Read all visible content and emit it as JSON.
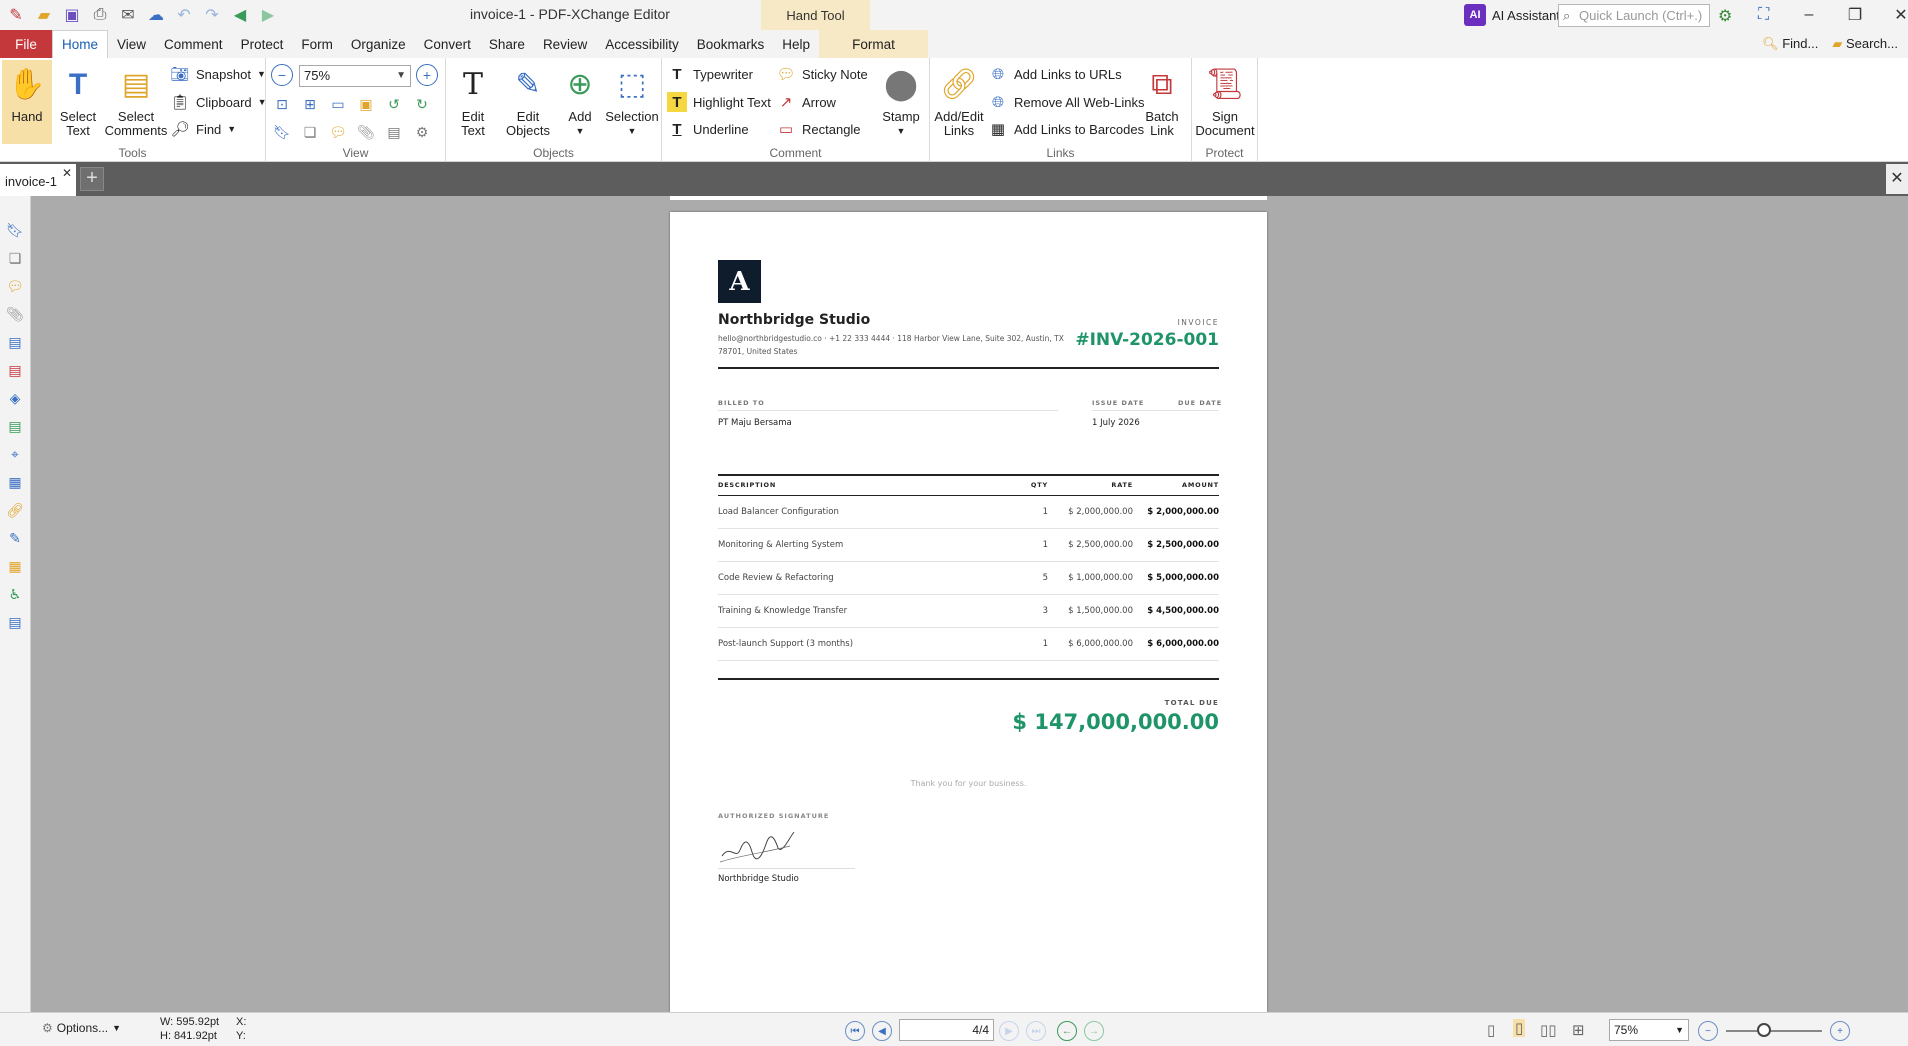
{
  "window": {
    "title": "invoice-1 - PDF-XChange Editor",
    "context_tab_group": "Hand Tool",
    "ai_assistant": "AI Assistant",
    "quick_launch_placeholder": "Quick Launch (Ctrl+.)"
  },
  "menu": {
    "file": "File",
    "items": [
      "Home",
      "View",
      "Comment",
      "Protect",
      "Form",
      "Organize",
      "Convert",
      "Share",
      "Review",
      "Accessibility",
      "Bookmarks",
      "Help"
    ],
    "context_item": "Format",
    "find": "Find...",
    "search": "Search..."
  },
  "ribbon": {
    "tools": {
      "label": "Tools",
      "hand": "Hand",
      "select_text_1": "Select",
      "select_text_2": "Text",
      "select_comments_1": "Select",
      "select_comments_2": "Comments",
      "snapshot": "Snapshot",
      "clipboard": "Clipboard",
      "find": "Find"
    },
    "view": {
      "label": "View",
      "zoom": "75%"
    },
    "objects": {
      "label": "Objects",
      "edit_text_1": "Edit",
      "edit_text_2": "Text",
      "edit_objects_1": "Edit",
      "edit_objects_2": "Objects",
      "add": "Add",
      "selection": "Selection"
    },
    "comment": {
      "label": "Comment",
      "typewriter": "Typewriter",
      "highlight": "Highlight Text",
      "underline": "Underline",
      "sticky": "Sticky Note",
      "arrow": "Arrow",
      "rectangle": "Rectangle",
      "stamp": "Stamp"
    },
    "links": {
      "label": "Links",
      "add_edit_1": "Add/Edit",
      "add_edit_2": "Links",
      "add_urls": "Add Links to URLs",
      "remove_web": "Remove All Web-Links",
      "add_barcodes": "Add Links to Barcodes",
      "batch_1": "Batch",
      "batch_2": "Link"
    },
    "protect": {
      "label": "Protect",
      "sign_1": "Sign",
      "sign_2": "Document"
    }
  },
  "tabs": {
    "document": "invoice-1"
  },
  "invoice": {
    "logo_letter": "A",
    "company": "Northbridge Studio",
    "contact_line": "hello@northbridgestudio.co · +1 22 333 4444 · 118 Harbor View Lane, Suite 302, Austin, TX 78701, United States",
    "invoice_label": "INVOICE",
    "invoice_number": "#INV-2026-001",
    "billed_to_label": "BILLED TO",
    "issue_date_label": "ISSUE DATE",
    "due_date_label": "DUE DATE",
    "billed_to": "PT Maju Bersama",
    "issue_date": "1 July 2026",
    "columns": {
      "description": "DESCRIPTION",
      "qty": "QTY",
      "rate": "RATE",
      "amount": "AMOUNT"
    },
    "items": [
      {
        "description": "Load Balancer Configuration",
        "qty": "1",
        "rate": "$ 2,000,000.00",
        "amount": "$ 2,000,000.00"
      },
      {
        "description": "Monitoring & Alerting System",
        "qty": "1",
        "rate": "$ 2,500,000.00",
        "amount": "$ 2,500,000.00"
      },
      {
        "description": "Code Review & Refactoring",
        "qty": "5",
        "rate": "$ 1,000,000.00",
        "amount": "$ 5,000,000.00"
      },
      {
        "description": "Training & Knowledge Transfer",
        "qty": "3",
        "rate": "$ 1,500,000.00",
        "amount": "$ 4,500,000.00"
      },
      {
        "description": "Post-launch Support (3 months)",
        "qty": "1",
        "rate": "$ 6,000,000.00",
        "amount": "$ 6,000,000.00"
      }
    ],
    "total_label": "TOTAL DUE",
    "total": "$ 147,000,000.00",
    "thanks": "Thank you for your business.",
    "signature_label": "AUTHORIZED SIGNATURE",
    "signature_name": "Northbridge Studio"
  },
  "status": {
    "options": "Options...",
    "width": "W: 595.92pt",
    "height": "H: 841.92pt",
    "x": "X:",
    "y": "Y:",
    "page": "4/4",
    "zoom": "75%"
  },
  "colors": {
    "accent_green": "#1e9468",
    "file_red": "#c4373a",
    "context_tab": "#f7e9c5"
  }
}
